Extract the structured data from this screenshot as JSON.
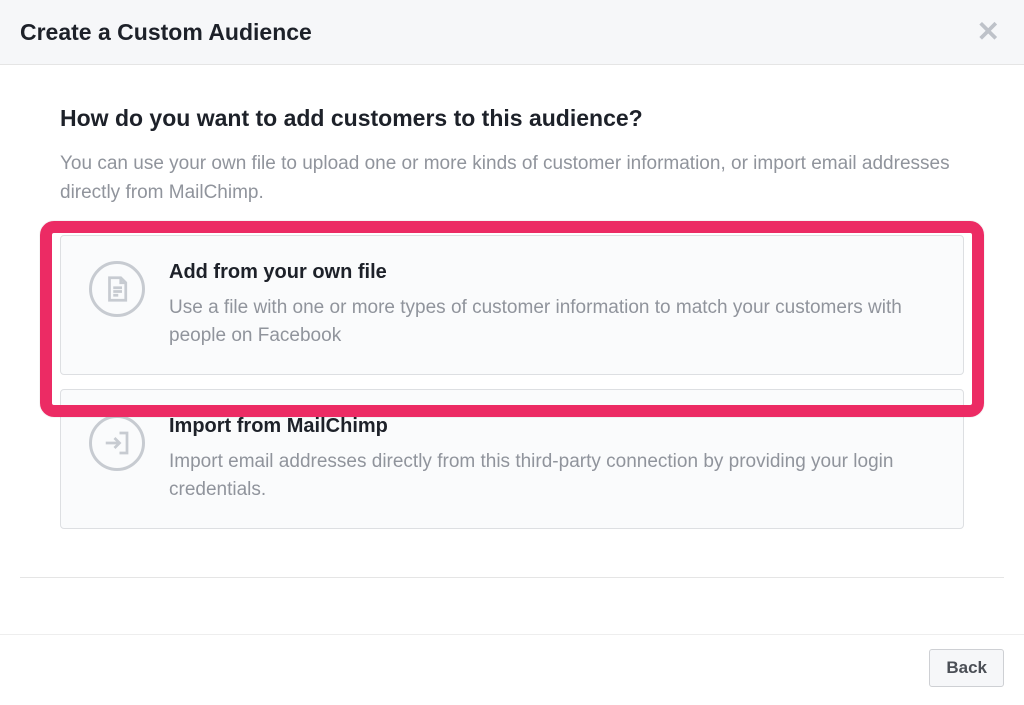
{
  "header": {
    "title": "Create a Custom Audience"
  },
  "body": {
    "section_title": "How do you want to add customers to this audience?",
    "section_desc": "You can use your own file to upload one or more kinds of customer information, or import email addresses directly from MailChimp.",
    "options": [
      {
        "title": "Add from your own file",
        "desc": "Use a file with one or more types of customer information to match your customers with people on Facebook"
      },
      {
        "title": "Import from MailChimp",
        "desc": "Import email addresses directly from this third-party connection by providing your login credentials."
      }
    ]
  },
  "footer": {
    "back_label": "Back"
  }
}
